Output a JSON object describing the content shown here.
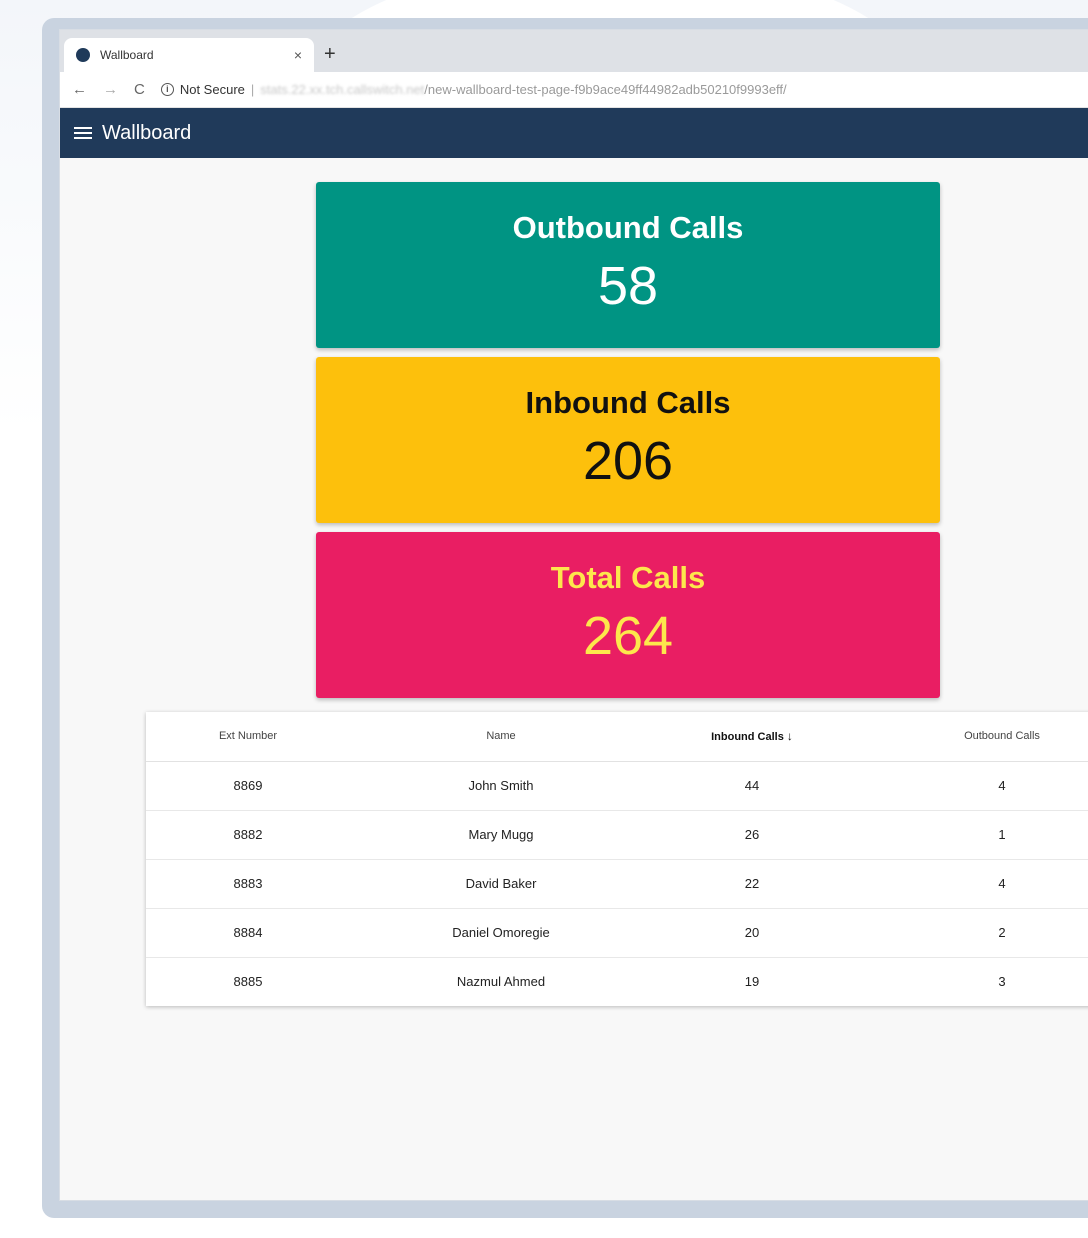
{
  "browser": {
    "tab_title": "Wallboard",
    "tab_close": "×",
    "new_tab": "+",
    "security_label": "Not Secure",
    "url_host": "stats.22.xx.tch.callswitch.net",
    "url_path": "/new-wallboard-test-page-f9b9ace49ff44982adb50210f9993eff/"
  },
  "appbar": {
    "title": "Wallboard"
  },
  "cards": [
    {
      "title": "Outbound Calls",
      "value": "58",
      "bg": "#009483",
      "title_color": "#ffffff",
      "value_color": "#ffffff"
    },
    {
      "title": "Inbound Calls",
      "value": "206",
      "bg": "#fdc00c",
      "title_color": "#111111",
      "value_color": "#111111"
    },
    {
      "title": "Total Calls",
      "value": "264",
      "bg": "#e91e63",
      "title_color": "#fde74c",
      "value_color": "#fde74c"
    }
  ],
  "table": {
    "headers": [
      "Ext Number",
      "Name",
      "Inbound Calls",
      "Outbound Calls"
    ],
    "sort_arrow": "↓",
    "rows": [
      [
        "8869",
        "John Smith",
        "44",
        "4"
      ],
      [
        "8882",
        "Mary Mugg",
        "26",
        "1"
      ],
      [
        "8883",
        "David Baker",
        "22",
        "4"
      ],
      [
        "8884",
        "Daniel Omoregie",
        "20",
        "2"
      ],
      [
        "8885",
        "Nazmul Ahmed",
        "19",
        "3"
      ]
    ]
  }
}
